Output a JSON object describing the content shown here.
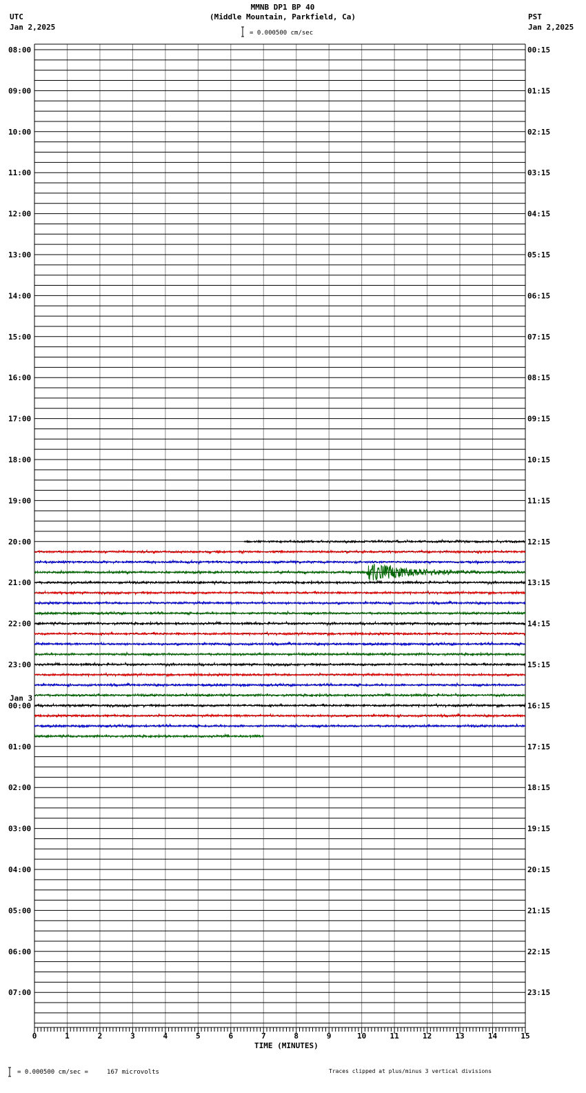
{
  "header": {
    "title": "MMNB DP1 BP 40",
    "subtitle": "(Middle Mountain, Parkfield, Ca)",
    "left_tz": "UTC",
    "left_date": "Jan 2,2025",
    "right_tz": "PST",
    "right_date": "Jan 2,2025",
    "scale_text": "= 0.000500 cm/sec"
  },
  "footer": {
    "scale_text": "= 0.000500 cm/sec =     167 microvolts",
    "clip_note": "Traces clipped at plus/minus 3 vertical divisions"
  },
  "chart_data": {
    "type": "line",
    "title": "MMNB DP1 BP 40",
    "xlabel": "TIME (MINUTES)",
    "xlim": [
      0,
      15
    ],
    "x_ticks": [
      "0",
      "1",
      "2",
      "3",
      "4",
      "5",
      "6",
      "7",
      "8",
      "9",
      "10",
      "11",
      "12",
      "13",
      "14",
      "15"
    ],
    "rows_per_hour": 4,
    "left_labels": [
      "08:00",
      "09:00",
      "10:00",
      "11:00",
      "12:00",
      "13:00",
      "14:00",
      "15:00",
      "16:00",
      "17:00",
      "18:00",
      "19:00",
      "20:00",
      "21:00",
      "22:00",
      "23:00",
      "00:00",
      "01:00",
      "02:00",
      "03:00",
      "04:00",
      "05:00",
      "06:00",
      "07:00"
    ],
    "left_date_change": {
      "label": "Jan 3",
      "before": "00:00"
    },
    "right_labels": [
      "00:15",
      "01:15",
      "02:15",
      "03:15",
      "04:15",
      "05:15",
      "06:15",
      "07:15",
      "08:15",
      "09:15",
      "10:15",
      "11:15",
      "12:15",
      "13:15",
      "14:15",
      "15:15",
      "16:15",
      "17:15",
      "18:15",
      "19:15",
      "20:15",
      "21:15",
      "22:15",
      "23:15"
    ],
    "trace_colors": [
      "#000000",
      "#dd0000",
      "#0000cc",
      "#006600"
    ],
    "data_start": {
      "row_utc": "20:00",
      "minute": 6.4
    },
    "data_end": {
      "row_utc": "00:45",
      "minute": 7.0
    },
    "event": {
      "row_utc": "20:45",
      "start_minute": 10.15,
      "peak_divisions": 3,
      "duration_minutes": 4.8
    },
    "noise_divisions": 0.25
  }
}
